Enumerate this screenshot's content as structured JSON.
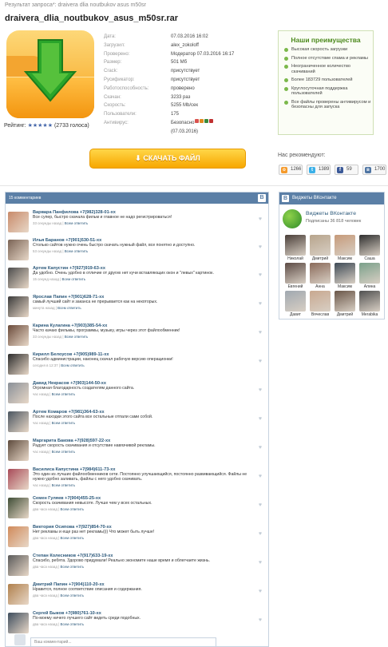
{
  "breadcrumb": {
    "prefix": "Результат запроса*:",
    "query": "draivera dlia noutbukov asus m50sr"
  },
  "file": {
    "title": "draivera_dlia_noutbukov_asus_m50sr.rar",
    "rating_label": "Рейтинг:",
    "rating_stars": "★★★★★",
    "rating_votes": "(2733 голоса)",
    "info": [
      {
        "k": "Дата:",
        "v": "07.03.2016 16:02"
      },
      {
        "k": "Загрузил:",
        "v": "alex_zokoloff"
      },
      {
        "k": "Проверено:",
        "v": "Модератор 07.03.2016 16:17"
      },
      {
        "k": "Размер:",
        "v": "501 Мб"
      },
      {
        "k": "Crack:",
        "v": "присутствует"
      },
      {
        "k": "Русификатор:",
        "v": "присутствует"
      },
      {
        "k": "Работоспособность:",
        "v": "проверено"
      },
      {
        "k": "Скачан:",
        "v": "3233 раз"
      },
      {
        "k": "Скорость:",
        "v": "5255 Mb/сек"
      },
      {
        "k": "Пользователи:",
        "v": "175"
      },
      {
        "k": "Антивирус:",
        "v": "Безопасно"
      },
      {
        "k": "",
        "v": "(07.03.2016)"
      }
    ]
  },
  "advantages": {
    "title": "Наши преимущества",
    "items": [
      "Высокая скорость загрузки",
      "Полное отсутствие спама и рекламы",
      "Неограниченное количество скачиваний",
      "Более 183729 пользователей",
      "Круглосуточная поддержка пользователей",
      "Все файлы проверены антивирусом и безопасны для запуска"
    ]
  },
  "download_button": "СКАЧАТЬ ФАЙЛ",
  "recommend": {
    "label": "Нас рекомендуют:",
    "shares": [
      {
        "icon": "odnoklassniki-icon",
        "glyph": "о",
        "count": "1266",
        "color": "#f59a2b"
      },
      {
        "icon": "twitter-icon",
        "glyph": "t",
        "count": "1389",
        "color": "#3ab0e8"
      },
      {
        "icon": "facebook-icon",
        "glyph": "f",
        "count": "59",
        "color": "#3b5998"
      },
      {
        "icon": "vk-icon",
        "glyph": "в",
        "count": "1700",
        "color": "#4f75a3"
      }
    ]
  },
  "chat": {
    "header": "15 комментариев",
    "messages": [
      {
        "name": "Варвара Панфилова +7(982)328-01-хх",
        "text": "Все супер, быстро скачала фильм и главное не надо регистрироваться!",
        "meta": "33 секунды назад",
        "reply": "Всем ответить",
        "color": "#c88a6a"
      },
      {
        "name": "Илья Баранов +7(901)530-51-хх",
        "text": "Столько сайтов нужно очень быстро скачать нужный файл, все понятно и доступно.",
        "meta": "53 секунды назад",
        "reply": "Всем ответить",
        "color": "#7a6355"
      },
      {
        "name": "Артем Капустин +7(927)919-63-хх",
        "text": "Да удобно. Очень удобно в отличие от других нет кучи вставляющих окон и \"левых\" картинок.",
        "meta": "15 секунд назад",
        "reply": "Всем ответить",
        "color": "#4c4c4c"
      },
      {
        "name": "Ярослав Папин +7(901)628-71-хх",
        "text": "самый лучший сайт и заканса не прерывается как на некоторых.",
        "meta": "минута назад",
        "reply": "Всем ответить",
        "color": "#3a3a3a"
      },
      {
        "name": "Карина Кулагина +7(903)385-54-хх",
        "text": "Часто качаю фильмы, программы, музыку, игры через этот файлообменник!",
        "meta": "33 секунды назад",
        "reply": "Всем ответить",
        "color": "#6a4a3a"
      },
      {
        "name": "Кирилл Белоусов +7(905)989-11-хх",
        "text": "Спасибо администрации, наконец скачал рабочую версию операционки!",
        "meta": "сегодня в 12:37",
        "reply": "Всем ответить",
        "color": "#2c2c2c"
      },
      {
        "name": "Давид Некрасов +7(903)144-50-хх",
        "text": "Огромная благодарность создателям данного сайта.",
        "meta": "час назад",
        "reply": "Всем ответить",
        "color": "#8a9098"
      },
      {
        "name": "Артем Комаров +7(981)364-63-хх",
        "text": "После находки этого сайта все остальные отпали сами собой.",
        "meta": "час назад",
        "reply": "Всем ответить",
        "color": "#4a5560"
      },
      {
        "name": "Маргарита Бакова +7(928)597-22-хх",
        "text": "Радует скорость скачивания и отсутствие навязчивой рекламы.",
        "meta": "час назад",
        "reply": "Всем ответить",
        "color": "#5d4a3c"
      },
      {
        "name": "Василиса Капустина +7(984)611-73-хх",
        "text": "Это один из лучших файлообменников сети. Постоянно улучшающийся, постоянно развивающийся. Файлы не нужно удобно заливать, файлы с него удобно скачивать.",
        "meta": "час назад",
        "reply": "Всем ответить",
        "color": "#a84a58"
      },
      {
        "name": "Семен Гуляев +7(904)455-25-хх",
        "text": "Скорость скачивания невысоте. Лучше чем у всех остальных.",
        "meta": "два часа назад",
        "reply": "Всем ответить",
        "color": "#3f4d36"
      },
      {
        "name": "Виктория Осипова +7(927)854-70-хх",
        "text": "Нет рекламы и еще раз нет рекламы))) Что может быть лучше!",
        "meta": "два часа назад",
        "reply": "Всем ответить",
        "color": "#d08a5a"
      },
      {
        "name": "Степан Колесников +7(917)633-19-хх",
        "text": "Спасибо, ребята. Здорово придумали! Реально экономите наше время и облегчаете жизнь.",
        "meta": "два часа назад",
        "reply": "Всем ответить",
        "color": "#5a5a5a"
      },
      {
        "name": "Дмитрий Папин +7(904)110-20-хх",
        "text": "Нравится, полное соответствие описания и содержания.",
        "meta": "два часа назад",
        "reply": "Всем ответить",
        "color": "#b0804c"
      },
      {
        "name": "Сергей Быков +7(980)761-10-хх",
        "text": "По-моему ничего лучшего сайт видеть среди подобных.",
        "meta": "два часа назад",
        "reply": "Всем ответить",
        "color": "#3e4d5e"
      }
    ]
  },
  "vk_widget": {
    "header": "Виджеты ВКонтакте",
    "group_name": "Виджеты ВКонтакте",
    "subscribers": "Подписаны 36 818 человек",
    "members": [
      {
        "name": "Николай",
        "color": "#4a3e38"
      },
      {
        "name": "Дмитрий",
        "color": "#b7a48c"
      },
      {
        "name": "Максим",
        "color": "#c69a7a"
      },
      {
        "name": "Саша",
        "color": "#2e2e2e"
      },
      {
        "name": "Евгений",
        "color": "#5c4a44"
      },
      {
        "name": "Анна",
        "color": "#8a6a5a"
      },
      {
        "name": "Максим",
        "color": "#3e4a56"
      },
      {
        "name": "Алина",
        "color": "#7aa08a"
      },
      {
        "name": "Давит",
        "color": "#a0a8b0"
      },
      {
        "name": "Вячеслав",
        "color": "#c8a890"
      },
      {
        "name": "Дмитрий",
        "color": "#6a5648"
      },
      {
        "name": "Merabika",
        "color": "#505050"
      }
    ]
  },
  "comment_input": {
    "placeholder": "Ваш комментарий..."
  }
}
